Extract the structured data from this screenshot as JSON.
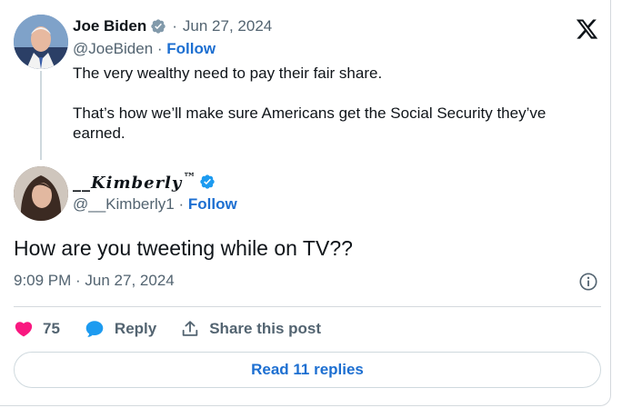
{
  "parent_tweet": {
    "author_name": "Joe Biden",
    "date": "Jun 27, 2024",
    "handle": "@JoeBiden",
    "follow_label": "Follow",
    "text_paragraphs": [
      "The very wealthy need to pay their fair share.",
      "That’s how we’ll make sure Americans get the Social Security they’ve earned."
    ],
    "verified_badge_color": "#829aab"
  },
  "reply": {
    "author_name": "__Kimberly",
    "trademark": "™",
    "handle": "@__Kimberly1",
    "follow_label": "Follow",
    "text": "How are you tweeting while on TV??",
    "timestamp": "9:09 PM · Jun 27, 2024",
    "verified_badge_color": "#1d9bf0"
  },
  "actions": {
    "like_count": "75",
    "reply_label": "Reply",
    "share_label": "Share this post"
  },
  "read_replies_label": "Read 11 replies",
  "icons": {
    "brand": "x-logo-icon",
    "like": "heart-icon",
    "reply": "speech-bubble-icon",
    "share": "share-upload-icon",
    "info": "info-icon"
  },
  "colors": {
    "link": "#1d6fd1",
    "heart": "#f91880",
    "reply_bubble": "#1d9bf0",
    "muted_text": "#536471"
  }
}
